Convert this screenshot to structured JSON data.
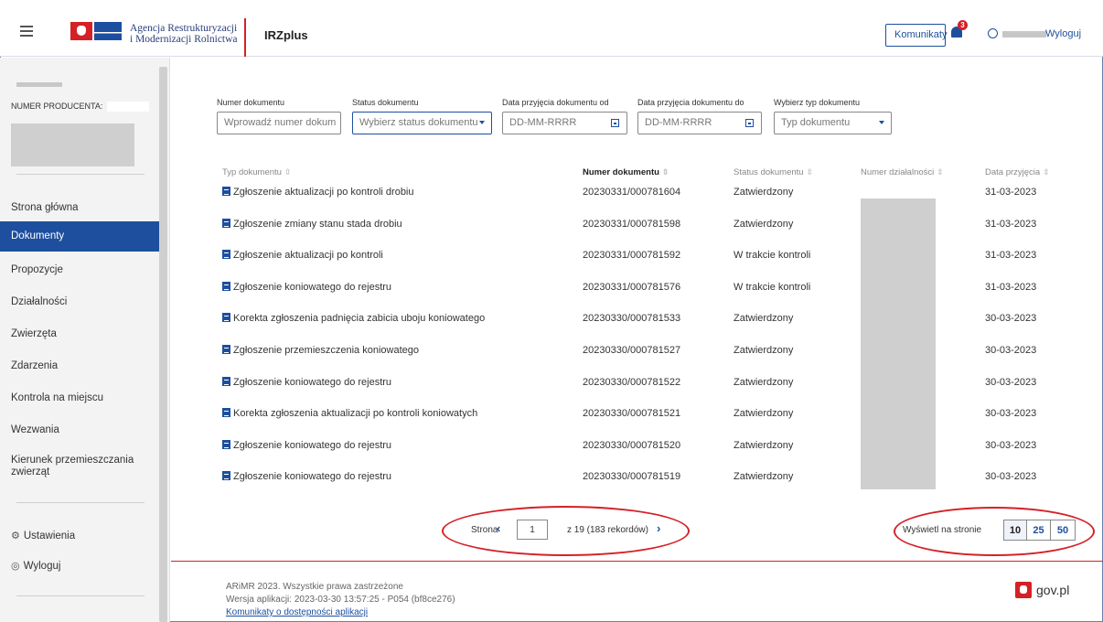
{
  "header": {
    "agency_line1": "Agencja Restrukturyzacji",
    "agency_line2": "i Modernizacji Rolnictwa",
    "app_name": "IRZplus",
    "komunikaty_label": "Komunikaty",
    "notifications_count": "3",
    "logout_label": "Wyloguj"
  },
  "sidebar": {
    "producer_label": "NUMER PRODUCENTA:",
    "items": [
      {
        "label": "Strona główna"
      },
      {
        "label": "Dokumenty"
      },
      {
        "label": "Propozycje"
      },
      {
        "label": "Działalności"
      },
      {
        "label": "Zwierzęta"
      },
      {
        "label": "Zdarzenia"
      },
      {
        "label": "Kontrola na miejscu"
      },
      {
        "label": "Wezwania"
      },
      {
        "label": "Kierunek przemieszczania zwierząt"
      }
    ],
    "settings_label": "Ustawienia",
    "logout_label": "Wyloguj",
    "active_item": "Dokumenty"
  },
  "filters": {
    "doc_number_label": "Numer dokumentu",
    "doc_number_placeholder": "Wprowadź numer dokum",
    "status_label": "Status dokumentu",
    "status_placeholder": "Wybierz status dokumentu",
    "date_from_label": "Data przyjęcia dokumentu od",
    "date_from_placeholder": "DD-MM-RRRR",
    "date_to_label": "Data przyjęcia dokumentu do",
    "date_to_placeholder": "DD-MM-RRRR",
    "type_label": "Wybierz typ dokumentu",
    "type_placeholder": "Typ dokumentu"
  },
  "table": {
    "columns": [
      "Typ dokumentu",
      "Numer dokumentu",
      "Status dokumentu",
      "Numer działalności",
      "Data przyjęcia"
    ],
    "rows": [
      {
        "type": "Zgłoszenie aktualizacji po kontroli drobiu",
        "number": "20230331/000781604",
        "status": "Zatwierdzony",
        "date": "31-03-2023"
      },
      {
        "type": "Zgłoszenie zmiany stanu stada drobiu",
        "number": "20230331/000781598",
        "status": "Zatwierdzony",
        "date": "31-03-2023"
      },
      {
        "type": "Zgłoszenie aktualizacji po kontroli",
        "number": "20230331/000781592",
        "status": "W trakcie kontroli",
        "date": "31-03-2023"
      },
      {
        "type": "Zgłoszenie koniowatego do rejestru",
        "number": "20230331/000781576",
        "status": "W trakcie kontroli",
        "date": "31-03-2023"
      },
      {
        "type": "Korekta zgłoszenia padnięcia zabicia uboju koniowatego",
        "number": "20230330/000781533",
        "status": "Zatwierdzony",
        "date": "30-03-2023"
      },
      {
        "type": "Zgłoszenie przemieszczenia koniowatego",
        "number": "20230330/000781527",
        "status": "Zatwierdzony",
        "date": "30-03-2023"
      },
      {
        "type": "Zgłoszenie koniowatego do rejestru",
        "number": "20230330/000781522",
        "status": "Zatwierdzony",
        "date": "30-03-2023"
      },
      {
        "type": "Korekta zgłoszenia aktualizacji po kontroli koniowatych",
        "number": "20230330/000781521",
        "status": "Zatwierdzony",
        "date": "30-03-2023"
      },
      {
        "type": "Zgłoszenie koniowatego do rejestru",
        "number": "20230330/000781520",
        "status": "Zatwierdzony",
        "date": "30-03-2023"
      },
      {
        "type": "Zgłoszenie koniowatego do rejestru",
        "number": "20230330/000781519",
        "status": "Zatwierdzony",
        "date": "30-03-2023"
      }
    ]
  },
  "pagination": {
    "page_label": "Strona",
    "current_page": "1",
    "total_text": "z 19 (183 rekordów)",
    "per_page_label": "Wyświetl na stronie",
    "per_page_options": [
      "10",
      "25",
      "50"
    ],
    "per_page_selected": "10"
  },
  "footer": {
    "copyright": "ARiMR 2023. Wszystkie prawa zastrzeżone",
    "version": "Wersja aplikacji: 2023-03-30 13:57:25 - P054 (bf8ce276)",
    "availability_link": "Komunikaty o dostępności aplikacji",
    "gov_label": "gov.pl"
  },
  "colors": {
    "primary": "#1d4f9e",
    "accent_red": "#d42127"
  }
}
